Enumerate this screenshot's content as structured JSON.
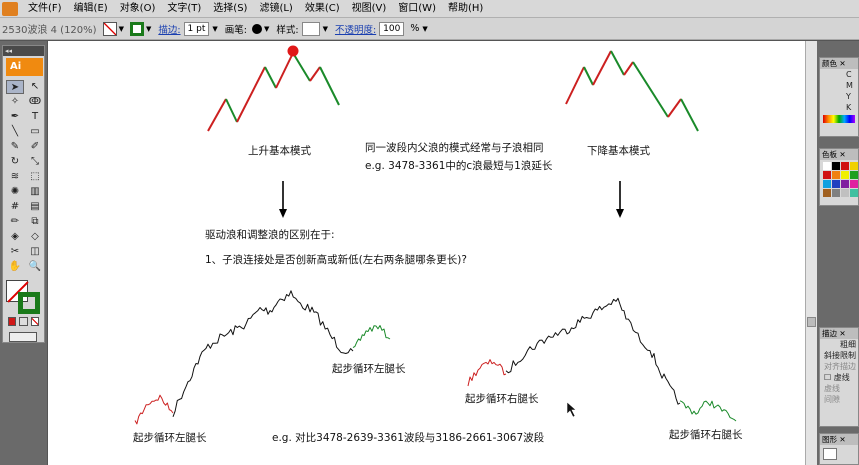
{
  "menubar": {
    "items": [
      "文件(F)",
      "编辑(E)",
      "对象(O)",
      "文字(T)",
      "选择(S)",
      "滤镜(L)",
      "效果(C)",
      "视图(V)",
      "窗口(W)",
      "帮助(H)"
    ]
  },
  "control_bar": {
    "document_title": "2530波浪 4 (120%)",
    "stroke_label": "描边:",
    "stroke_weight": "1 pt",
    "brush_label": "画笔:",
    "style_label": "样式:",
    "opacity_label": "不透明度:",
    "opacity_value": "100",
    "opacity_unit": "%"
  },
  "toolbox": {
    "app_badge": "Ai",
    "tools": [
      "selection-tool",
      "direct-selection-tool",
      "magic-wand-tool",
      "lasso-tool",
      "pen-tool",
      "type-tool",
      "line-tool",
      "rectangle-tool",
      "paintbrush-tool",
      "pencil-tool",
      "rotate-tool",
      "scale-tool",
      "warp-tool",
      "free-transform-tool",
      "symbol-sprayer-tool",
      "column-graph-tool",
      "mesh-tool",
      "gradient-tool",
      "eyedropper-tool",
      "blend-tool",
      "live-paint-tool",
      "live-paint-selection-tool",
      "slice-tool",
      "eraser-tool",
      "hand-tool",
      "zoom-tool"
    ],
    "tool_glyphs": [
      "➤",
      "↖",
      "✧",
      "ↂ",
      "✒",
      "T",
      "╲",
      "▭",
      "✎",
      "✐",
      "↻",
      "⤡",
      "≋",
      "⬚",
      "✺",
      "▥",
      "#",
      "▤",
      "✏",
      "⧉",
      "◈",
      "◇",
      "✂",
      "◫",
      "✋",
      "🔍"
    ]
  },
  "canvas": {
    "label_up_pattern": "上升基本模式",
    "label_down_pattern": "下降基本模式",
    "note_line1": "同一波段内父浪的模式经常与子浪相同",
    "note_line2": "e.g. 3478-3361中的c浪最短与1浪延长",
    "heading_difference": "驱动浪和调整浪的区别在于:",
    "question_1": "1、子浪连接处是否创新高或新低(左右两条腿哪条更长)?",
    "label_left_leg_long_a": "起步循环左腿长",
    "label_right_leg_long_a": "起步循环右腿长",
    "label_left_leg_long_b": "起步循环左腿长",
    "label_right_leg_long_b": "起步循环右腿长",
    "bottom_example": "e.g. 对比3478-2639-3361波段与3186-2661-3067波段",
    "colors": {
      "up_segment": "#cc2020",
      "down_segment": "#1a8a2a",
      "peak_dot": "#e01818",
      "noise_line": "#111111"
    }
  },
  "right_panels": {
    "color_panel": {
      "title": "颜色",
      "channels": [
        "C",
        "M",
        "Y",
        "K"
      ]
    },
    "swatch_panel": {
      "title": "色板"
    },
    "stroke_panel": {
      "title": "描边",
      "lines": [
        "粗细",
        "斜接限制",
        "对齐描边",
        "虚线",
        "虚线",
        "间隙"
      ]
    },
    "graphic_style_panel": {
      "title": "图形"
    }
  }
}
